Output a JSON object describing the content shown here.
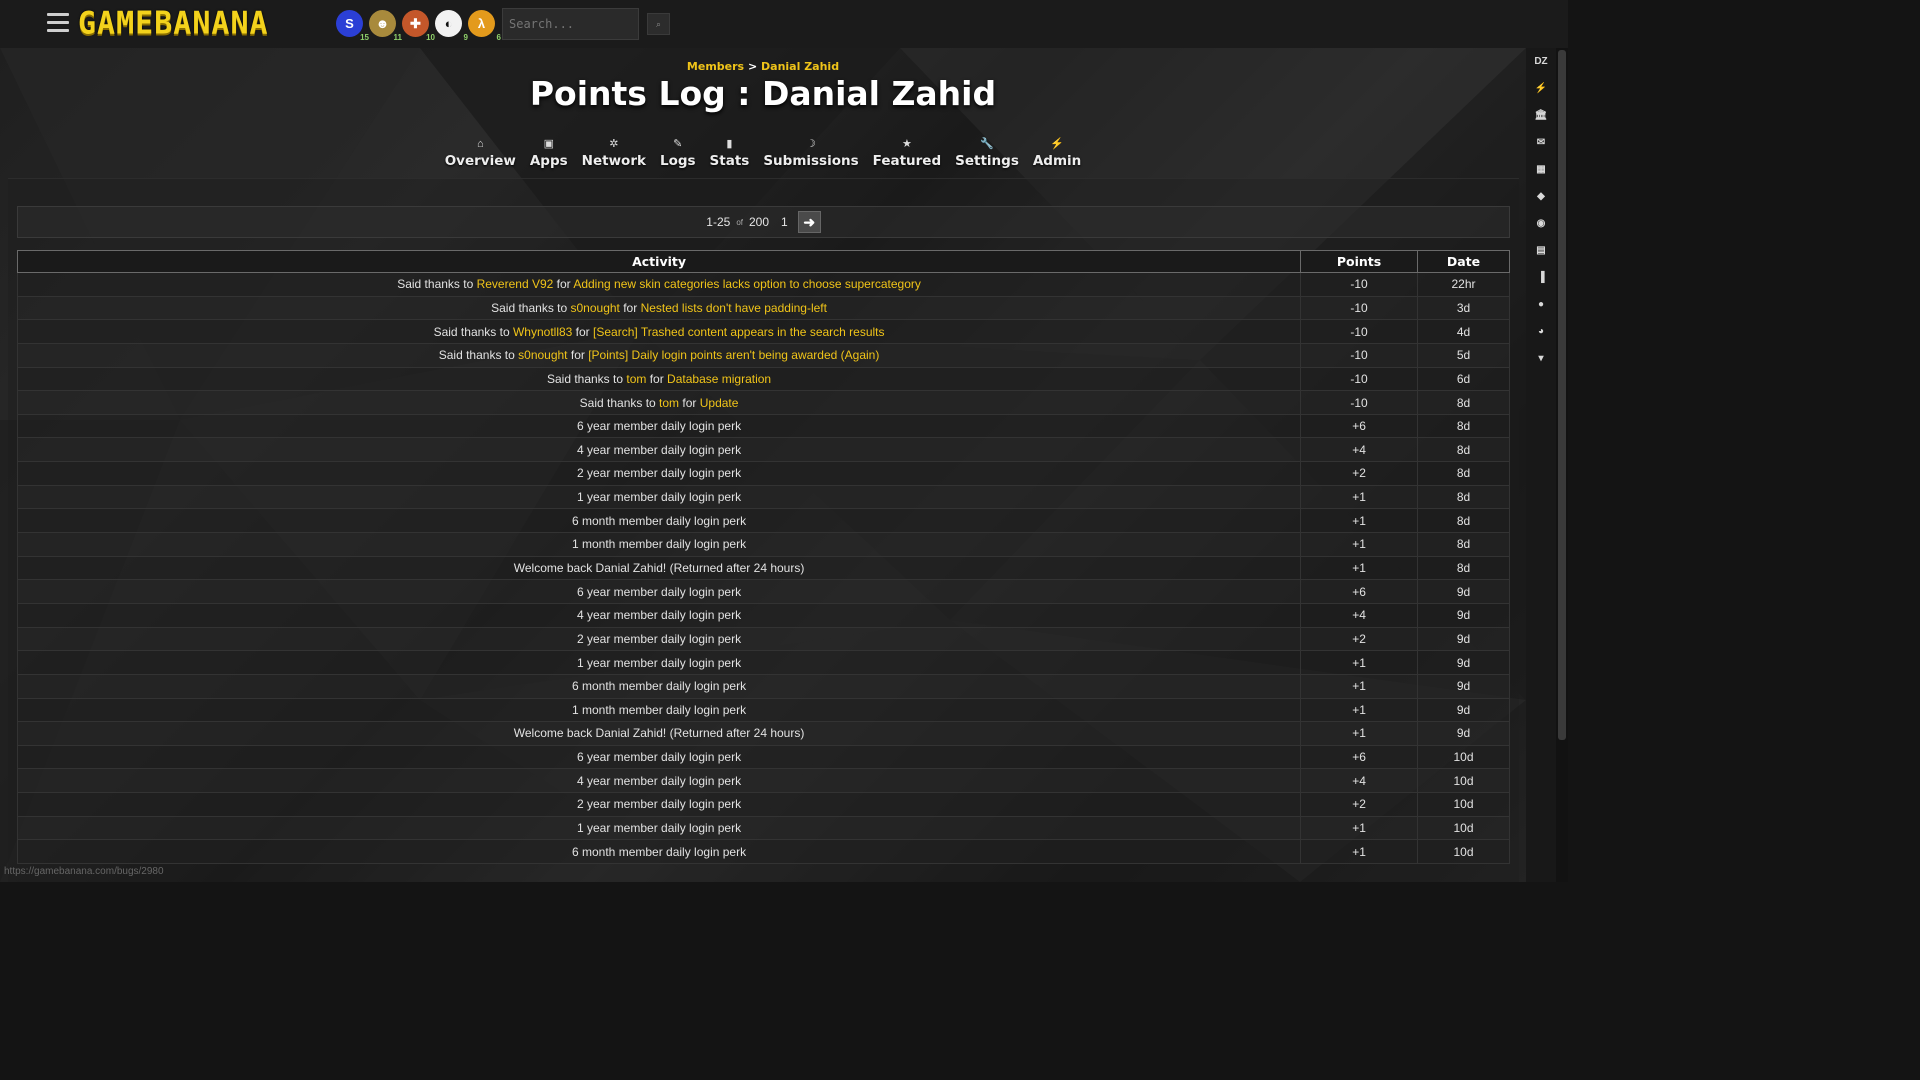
{
  "topbar": {
    "logo": "GAMEBANANA",
    "search_placeholder": "Search...",
    "search_button": "⌕",
    "games": [
      {
        "icon": "sonic-game-icon",
        "glyph": "S",
        "count": "15",
        "color": "#2b3fd6"
      },
      {
        "icon": "fallout-game-icon",
        "glyph": "☻",
        "count": "11",
        "color": "#a88a3c"
      },
      {
        "icon": "tf2-game-icon",
        "glyph": "✚",
        "count": "10",
        "color": "#c4572a"
      },
      {
        "icon": "smash-game-icon",
        "glyph": "◐",
        "count": "9",
        "color": "#f2f2f2"
      },
      {
        "icon": "halflife-game-icon",
        "glyph": "λ",
        "count": "6",
        "color": "#e39a1c"
      }
    ]
  },
  "rightrail": {
    "items": [
      "DZ",
      "⚡",
      "🏛",
      "✉",
      "▦",
      "◆",
      "◉",
      "▤",
      "▐",
      "●",
      "◕",
      "▾"
    ]
  },
  "breadcrumb": {
    "parent": "Members",
    "sep": ">",
    "current": "Danial Zahid"
  },
  "title": "Points Log : Danial Zahid",
  "tabs": [
    {
      "label": "Overview",
      "icon": "⌂",
      "name": "home-icon"
    },
    {
      "label": "Apps",
      "icon": "▣",
      "name": "apps-icon"
    },
    {
      "label": "Network",
      "icon": "✲",
      "name": "network-icon"
    },
    {
      "label": "Logs",
      "icon": "✎",
      "name": "logs-icon"
    },
    {
      "label": "Stats",
      "icon": "▮",
      "name": "stats-icon"
    },
    {
      "label": "Submissions",
      "icon": "☽",
      "name": "submissions-icon"
    },
    {
      "label": "Featured",
      "icon": "★",
      "name": "featured-icon"
    },
    {
      "label": "Settings",
      "icon": "🔧",
      "name": "settings-icon"
    },
    {
      "label": "Admin",
      "icon": "⚡",
      "name": "admin-icon"
    }
  ],
  "pager": {
    "range": "1-25",
    "of": "of",
    "total": "200",
    "page": "1",
    "next": "➜"
  },
  "table": {
    "headers": [
      "Activity",
      "Points",
      "Date"
    ],
    "rows": [
      {
        "parts": [
          {
            "t": "Said thanks to "
          },
          {
            "t": "Reverend V92",
            "l": true
          },
          {
            "t": " for "
          },
          {
            "t": "Adding new skin categories lacks option to choose supercategory",
            "l": true
          }
        ],
        "points": "-10",
        "date": "22hr"
      },
      {
        "parts": [
          {
            "t": "Said thanks to "
          },
          {
            "t": "s0nought",
            "l": true
          },
          {
            "t": " for "
          },
          {
            "t": "Nested lists don't have padding-left",
            "l": true
          }
        ],
        "points": "-10",
        "date": "3d"
      },
      {
        "parts": [
          {
            "t": "Said thanks to "
          },
          {
            "t": "Whynotll83",
            "l": true
          },
          {
            "t": " for "
          },
          {
            "t": "[Search] Trashed content appears in the search results",
            "l": true
          }
        ],
        "points": "-10",
        "date": "4d"
      },
      {
        "parts": [
          {
            "t": "Said thanks to "
          },
          {
            "t": "s0nought",
            "l": true
          },
          {
            "t": " for "
          },
          {
            "t": "[Points] Daily login points aren't being awarded (Again)",
            "l": true
          }
        ],
        "points": "-10",
        "date": "5d"
      },
      {
        "parts": [
          {
            "t": "Said thanks to "
          },
          {
            "t": "tom",
            "l": true
          },
          {
            "t": " for "
          },
          {
            "t": "Database migration",
            "l": true
          }
        ],
        "points": "-10",
        "date": "6d"
      },
      {
        "parts": [
          {
            "t": "Said thanks to "
          },
          {
            "t": "tom",
            "l": true
          },
          {
            "t": " for "
          },
          {
            "t": "Update",
            "l": true
          }
        ],
        "points": "-10",
        "date": "8d"
      },
      {
        "parts": [
          {
            "t": "6 year member daily login perk"
          }
        ],
        "points": "+6",
        "date": "8d"
      },
      {
        "parts": [
          {
            "t": "4 year member daily login perk"
          }
        ],
        "points": "+4",
        "date": "8d"
      },
      {
        "parts": [
          {
            "t": "2 year member daily login perk"
          }
        ],
        "points": "+2",
        "date": "8d"
      },
      {
        "parts": [
          {
            "t": "1 year member daily login perk"
          }
        ],
        "points": "+1",
        "date": "8d"
      },
      {
        "parts": [
          {
            "t": "6 month member daily login perk"
          }
        ],
        "points": "+1",
        "date": "8d"
      },
      {
        "parts": [
          {
            "t": "1 month member daily login perk"
          }
        ],
        "points": "+1",
        "date": "8d"
      },
      {
        "parts": [
          {
            "t": "Welcome back Danial Zahid! (Returned after 24 hours)"
          }
        ],
        "points": "+1",
        "date": "8d"
      },
      {
        "parts": [
          {
            "t": "6 year member daily login perk"
          }
        ],
        "points": "+6",
        "date": "9d"
      },
      {
        "parts": [
          {
            "t": "4 year member daily login perk"
          }
        ],
        "points": "+4",
        "date": "9d"
      },
      {
        "parts": [
          {
            "t": "2 year member daily login perk"
          }
        ],
        "points": "+2",
        "date": "9d"
      },
      {
        "parts": [
          {
            "t": "1 year member daily login perk"
          }
        ],
        "points": "+1",
        "date": "9d"
      },
      {
        "parts": [
          {
            "t": "6 month member daily login perk"
          }
        ],
        "points": "+1",
        "date": "9d"
      },
      {
        "parts": [
          {
            "t": "1 month member daily login perk"
          }
        ],
        "points": "+1",
        "date": "9d"
      },
      {
        "parts": [
          {
            "t": "Welcome back Danial Zahid! (Returned after 24 hours)"
          }
        ],
        "points": "+1",
        "date": "9d"
      },
      {
        "parts": [
          {
            "t": "6 year member daily login perk"
          }
        ],
        "points": "+6",
        "date": "10d"
      },
      {
        "parts": [
          {
            "t": "4 year member daily login perk"
          }
        ],
        "points": "+4",
        "date": "10d"
      },
      {
        "parts": [
          {
            "t": "2 year member daily login perk"
          }
        ],
        "points": "+2",
        "date": "10d"
      },
      {
        "parts": [
          {
            "t": "1 year member daily login perk"
          }
        ],
        "points": "+1",
        "date": "10d"
      },
      {
        "parts": [
          {
            "t": "6 month member daily login perk"
          }
        ],
        "points": "+1",
        "date": "10d"
      }
    ]
  },
  "status_url": "https://gamebanana.com/bugs/2980",
  "colors": {
    "accent": "#f0c419",
    "negative": "#d9342b",
    "positive": "#6fbf4a"
  }
}
